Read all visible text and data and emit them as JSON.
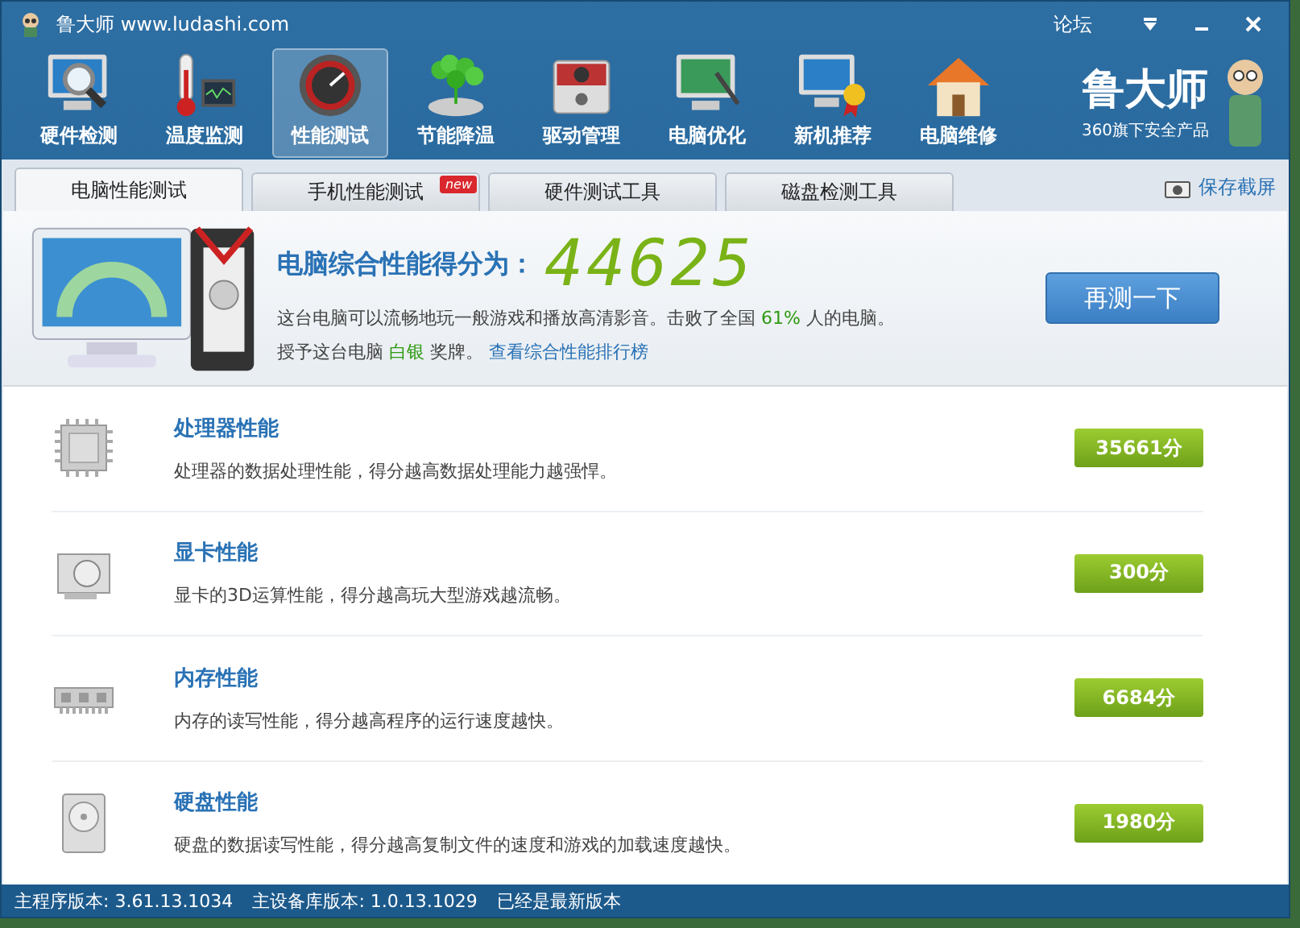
{
  "window": {
    "title": "鲁大师 www.ludashi.com",
    "menu_link": "论坛"
  },
  "toolbar": [
    {
      "label": "硬件检测",
      "selected": false
    },
    {
      "label": "温度监测",
      "selected": false
    },
    {
      "label": "性能测试",
      "selected": true
    },
    {
      "label": "节能降温",
      "selected": false
    },
    {
      "label": "驱动管理",
      "selected": false
    },
    {
      "label": "电脑优化",
      "selected": false
    },
    {
      "label": "新机推荐",
      "selected": false
    },
    {
      "label": "电脑维修",
      "selected": false
    }
  ],
  "brand": {
    "logo": "鲁大师",
    "tagline": "360旗下安全产品"
  },
  "tabs": [
    {
      "label": "电脑性能测试",
      "selected": true
    },
    {
      "label": "手机性能测试",
      "selected": false,
      "badge": "new"
    },
    {
      "label": "硬件测试工具",
      "selected": false
    },
    {
      "label": "磁盘检测工具",
      "selected": false
    }
  ],
  "save_screenshot": "保存截屏",
  "score": {
    "heading": "电脑综合性能得分为：",
    "value": "44625",
    "summary": {
      "before": "这台电脑可以流畅地玩一般游戏和播放高清影音。击败了全国 ",
      "highlight": "61%",
      "after": " 人的电脑。"
    },
    "medal": {
      "before": "授予这台电脑 ",
      "highlight": "白银",
      "after": " 奖牌。"
    },
    "ranking_link": "查看综合性能排行榜",
    "retest_button": "再测一下"
  },
  "categories": [
    {
      "name": "处理器性能",
      "description": "处理器的数据处理性能，得分越高数据处理能力越强悍。",
      "score": "35661分"
    },
    {
      "name": "显卡性能",
      "description": "显卡的3D运算性能，得分越高玩大型游戏越流畅。",
      "score": "300分"
    },
    {
      "name": "内存性能",
      "description": "内存的读写性能，得分越高程序的运行速度越快。",
      "score": "6684分"
    },
    {
      "name": "硬盘性能",
      "description": "硬盘的数据读写性能，得分越高复制文件的速度和游戏的加载速度越快。",
      "score": "1980分"
    }
  ],
  "status_bar": {
    "program_version": "主程序版本: 3.61.13.1034",
    "database_version": "主设备库版本: 1.0.13.1029",
    "update_status": "已经是最新版本"
  }
}
